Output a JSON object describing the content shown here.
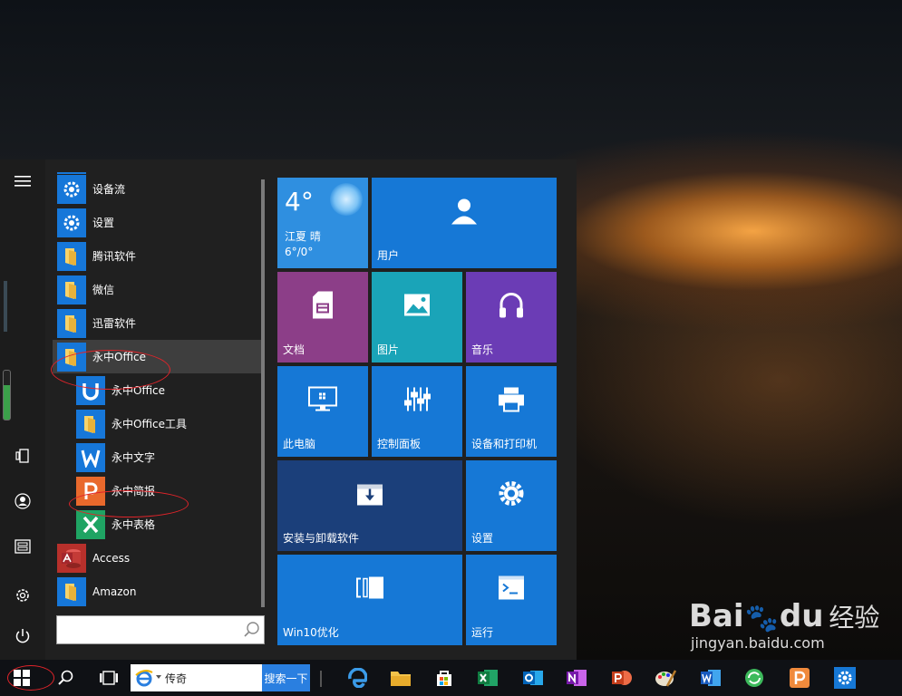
{
  "start_menu": {
    "app_list": [
      {
        "label": "设备流",
        "icon": "gear-icon",
        "color": "#1677d9"
      },
      {
        "label": "设置",
        "icon": "gear-icon",
        "color": "#1677d9"
      },
      {
        "label": "腾讯软件",
        "icon": "folder-icon",
        "color": "#1677d9"
      },
      {
        "label": "微信",
        "icon": "folder-icon",
        "color": "#1677d9"
      },
      {
        "label": "迅雷软件",
        "icon": "folder-icon",
        "color": "#1677d9"
      },
      {
        "label": "永中Office",
        "icon": "folder-icon",
        "color": "#1677d9",
        "selected": true
      },
      {
        "label": "永中Office",
        "icon": "yozo-office-icon",
        "color": "#1677d9",
        "sub": true
      },
      {
        "label": "永中Office工具",
        "icon": "folder-icon",
        "color": "#1677d9",
        "sub": true
      },
      {
        "label": "永中文字",
        "icon": "yozo-writer-icon",
        "color": "#1677d9",
        "sub": true
      },
      {
        "label": "永中简报",
        "icon": "yozo-presentation-icon",
        "color": "#e9692c",
        "sub": true
      },
      {
        "label": "永中表格",
        "icon": "yozo-spreadsheet-icon",
        "color": "#1fa463",
        "sub": true
      },
      {
        "label": "Access",
        "icon": "access-icon",
        "color": "#b7302b"
      },
      {
        "label": "Amazon",
        "icon": "folder-icon",
        "color": "#1677d9"
      }
    ],
    "search": {
      "value": "",
      "placeholder": ""
    },
    "tiles": {
      "weather": {
        "temp": "4°",
        "location": "江夏 晴",
        "range": "6°/0°",
        "color": "#2f8fe0"
      },
      "user": {
        "label": "用户",
        "color": "#1678d6"
      },
      "documents": {
        "label": "文档",
        "color": "#8c3e88"
      },
      "pictures": {
        "label": "图片",
        "color": "#1aa4b8"
      },
      "music": {
        "label": "音乐",
        "color": "#6b3cb5"
      },
      "this_pc": {
        "label": "此电脑",
        "color": "#1678d6"
      },
      "control_panel": {
        "label": "控制面板",
        "color": "#1678d6"
      },
      "devices_printers": {
        "label": "设备和打印机",
        "color": "#1678d6"
      },
      "install_uninstall": {
        "label": "安装与卸载软件",
        "color": "#1b3f7a"
      },
      "settings": {
        "label": "设置",
        "color": "#1678d6"
      },
      "win10_optimize": {
        "label": "Win10优化",
        "color": "#1678d6"
      },
      "run": {
        "label": "运行",
        "color": "#1678d6"
      }
    }
  },
  "taskbar": {
    "search_value": "传奇",
    "search_button": "搜索一下"
  },
  "watermark": {
    "brand": "Bai",
    "brand2": "du",
    "cn": "经验",
    "url": "jingyan.baidu.com"
  }
}
